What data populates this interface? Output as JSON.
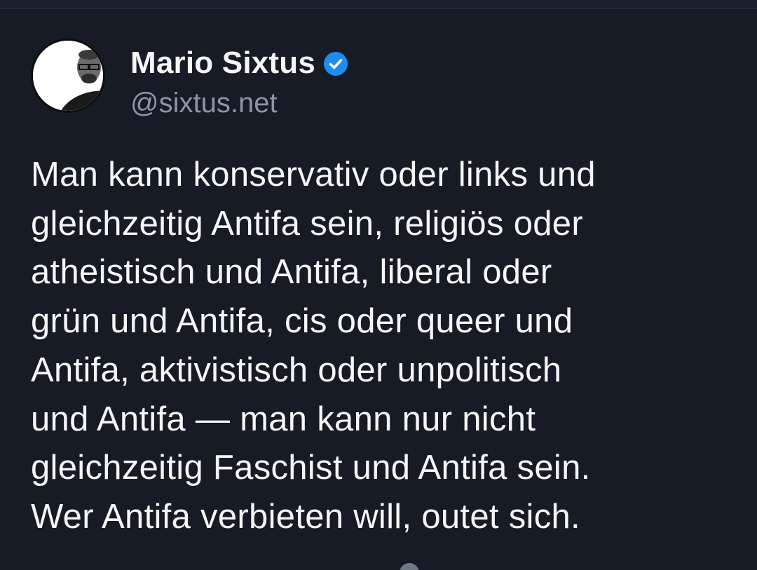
{
  "post": {
    "author": {
      "display_name": "Mario Sixtus",
      "handle": "@sixtus.net",
      "verified": true,
      "avatar_icon": "profile-photo-avatar"
    },
    "text": "Man kann konservativ oder links und\ngleichzeitig Antifa sein, religiös oder\natheistisch und Antifa, liberal oder\ngrün und Antifa, cis oder queer und\nAntifa, aktivistisch oder unpolitisch\nund Antifa — man kann nur nicht\ngleichzeitig Faschist und Antifa sein.\nWer Antifa verbieten will, outet sich."
  },
  "colors": {
    "background": "#161b25",
    "text": "#f4f6f8",
    "handle": "#8c96a3",
    "verified_badge": "#1d8cf0"
  }
}
